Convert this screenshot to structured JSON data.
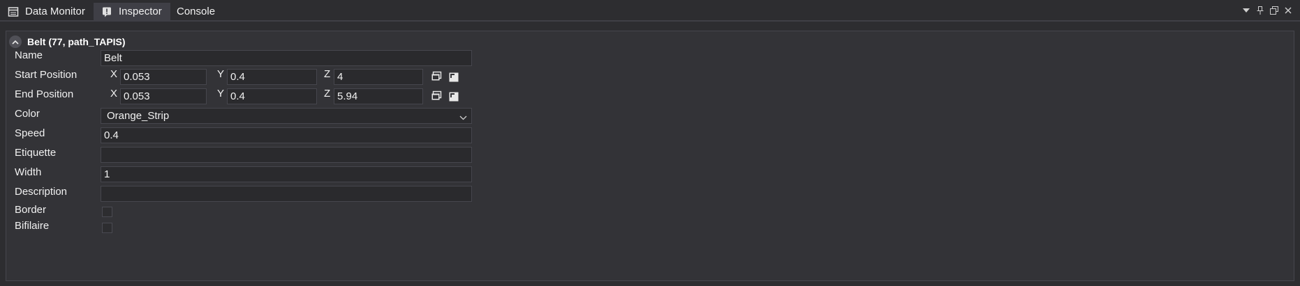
{
  "tabs": [
    {
      "label": "Data Monitor",
      "icon": "data-monitor-icon"
    },
    {
      "label": "Inspector",
      "icon": "inspector-icon"
    },
    {
      "label": "Console"
    }
  ],
  "inspector": {
    "title": "Belt (77, path_TAPIS)",
    "name": {
      "label": "Name",
      "value": "Belt"
    },
    "start_position": {
      "label": "Start Position",
      "x": "0.053",
      "y": "0.4",
      "z": "4"
    },
    "end_position": {
      "label": "End Position",
      "x": "0.053",
      "y": "0.4",
      "z": "5.94"
    },
    "axis_labels": {
      "x": "X",
      "y": "Y",
      "z": "Z"
    },
    "color": {
      "label": "Color",
      "value": "Orange_Strip"
    },
    "speed": {
      "label": "Speed",
      "value": "0.4"
    },
    "etiquette": {
      "label": "Etiquette",
      "value": ""
    },
    "width": {
      "label": "Width",
      "value": "1"
    },
    "description": {
      "label": "Description",
      "value": ""
    },
    "border": {
      "label": "Border",
      "checked": false
    },
    "bifilaire": {
      "label": "Bifilaire",
      "checked": false
    }
  },
  "colors": {
    "background": "#2d2d30",
    "active_tab": "#3f3f46",
    "field_bg": "#2a2a2d",
    "text": "#f1f1f1"
  }
}
